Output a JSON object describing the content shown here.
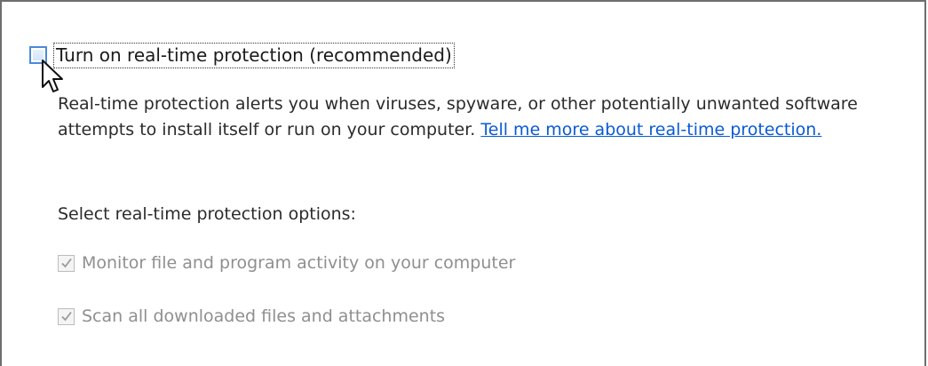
{
  "realtime": {
    "checkbox_checked": false,
    "label": "Turn on real-time protection (recommended)"
  },
  "description": {
    "text": "Real-time protection alerts you when viruses, spyware, or other potentially unwanted software attempts to install itself or run on your computer. ",
    "link_text": "Tell me more about real-time protection."
  },
  "options": {
    "heading": "Select real-time protection options:",
    "items": [
      {
        "label": "Monitor file and program activity on your computer",
        "checked": true,
        "disabled": true
      },
      {
        "label": "Scan all downloaded files and attachments",
        "checked": true,
        "disabled": true
      }
    ]
  },
  "icons": {
    "cursor": "mouse-pointer-icon",
    "checkmark": "checkmark-icon"
  },
  "colors": {
    "link": "#0a5ad6",
    "focus_checkbox_border": "#4a8ad8",
    "disabled_text": "#8f8f8f"
  }
}
